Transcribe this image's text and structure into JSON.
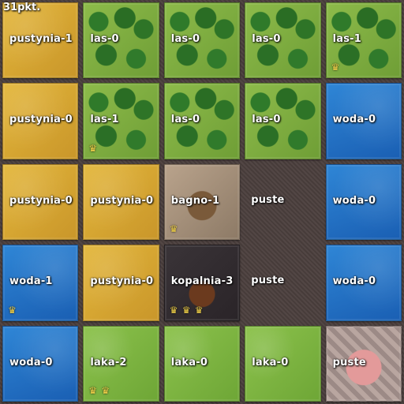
{
  "score": "31pkt.",
  "tiles": [
    {
      "label": "pustynia-1",
      "type": "pustynia",
      "crowns": 0
    },
    {
      "label": "las-0",
      "type": "las",
      "crowns": 0
    },
    {
      "label": "las-0",
      "type": "las",
      "crowns": 0
    },
    {
      "label": "las-0",
      "type": "las",
      "crowns": 0
    },
    {
      "label": "las-1",
      "type": "las",
      "crowns": 1
    },
    {
      "label": "pustynia-0",
      "type": "pustynia",
      "crowns": 0
    },
    {
      "label": "las-1",
      "type": "las",
      "crowns": 1
    },
    {
      "label": "las-0",
      "type": "las",
      "crowns": 0
    },
    {
      "label": "las-0",
      "type": "las",
      "crowns": 0
    },
    {
      "label": "woda-0",
      "type": "woda",
      "crowns": 0
    },
    {
      "label": "pustynia-0",
      "type": "pustynia",
      "crowns": 0
    },
    {
      "label": "pustynia-0",
      "type": "pustynia",
      "crowns": 0
    },
    {
      "label": "bagno-1",
      "type": "bagno",
      "crowns": 1
    },
    {
      "label": "puste",
      "type": "empty",
      "crowns": 0
    },
    {
      "label": "woda-0",
      "type": "woda",
      "crowns": 0
    },
    {
      "label": "woda-1",
      "type": "woda",
      "crowns": 1
    },
    {
      "label": "pustynia-0",
      "type": "pustynia",
      "crowns": 0
    },
    {
      "label": "kopalnia-3",
      "type": "kopalnia",
      "crowns": 3
    },
    {
      "label": "puste",
      "type": "empty",
      "crowns": 0
    },
    {
      "label": "woda-0",
      "type": "woda",
      "crowns": 0
    },
    {
      "label": "woda-0",
      "type": "woda",
      "crowns": 0
    },
    {
      "label": "laka-2",
      "type": "laka",
      "crowns": 2
    },
    {
      "label": "laka-0",
      "type": "laka",
      "crowns": 0
    },
    {
      "label": "laka-0",
      "type": "laka",
      "crowns": 0
    },
    {
      "label": "puste",
      "type": "special",
      "crowns": 0
    }
  ]
}
